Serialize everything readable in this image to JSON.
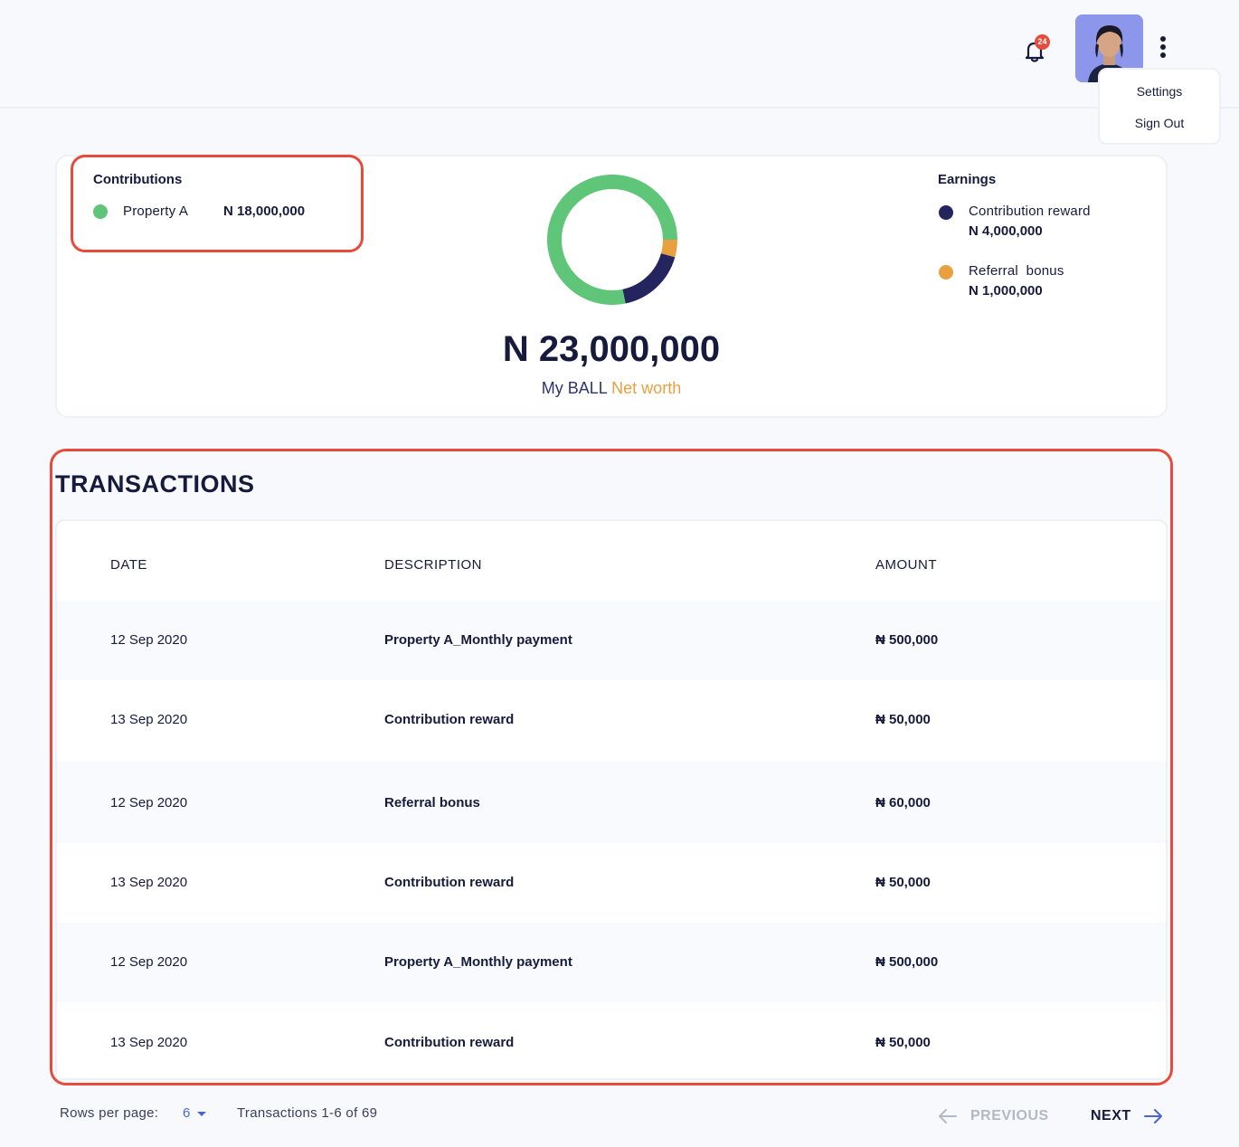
{
  "header": {
    "notification_count": "24",
    "menu": {
      "settings": "Settings",
      "sign_out": "Sign Out"
    }
  },
  "summary": {
    "contributions": {
      "heading": "Contributions",
      "items": [
        {
          "label": "Property A",
          "amount": "N 18,000,000",
          "color": "#5fc578"
        }
      ]
    },
    "earnings": {
      "heading": "Earnings",
      "items": [
        {
          "label": "Contribution reward",
          "amount": "N 4,000,000",
          "color": "#24245f"
        },
        {
          "label": "Referral  bonus",
          "amount": "N 1,000,000",
          "color": "#e9a03f"
        }
      ]
    },
    "networth_value": "N 23,000,000",
    "networth_label": "My BALL",
    "networth_accent": "Net worth"
  },
  "chart_data": {
    "type": "pie",
    "categories": [
      "Property A",
      "Contribution reward",
      "Referral bonus"
    ],
    "values": [
      18000000,
      4000000,
      1000000
    ],
    "colors": [
      "#5fc578",
      "#24245f",
      "#e9a03f"
    ]
  },
  "transactions": {
    "title": "TRANSACTIONS",
    "columns": {
      "date": "DATE",
      "description": "DESCRIPTION",
      "amount": "AMOUNT"
    },
    "rows": [
      {
        "date": "12 Sep 2020",
        "description": "Property A_Monthly payment",
        "amount": "₦ 500,000"
      },
      {
        "date": "13 Sep 2020",
        "description": "Contribution reward",
        "amount": "₦ 50,000"
      },
      {
        "date": "12 Sep 2020",
        "description": "Referral bonus",
        "amount": "₦ 60,000"
      },
      {
        "date": "13 Sep 2020",
        "description": "Contribution reward",
        "amount": "₦ 50,000"
      },
      {
        "date": "12 Sep 2020",
        "description": "Property A_Monthly payment",
        "amount": "₦ 500,000"
      },
      {
        "date": "13 Sep 2020",
        "description": "Contribution reward",
        "amount": "₦ 50,000"
      }
    ]
  },
  "pagination": {
    "rows_per_page_label": "Rows per page:",
    "rows_per_page_value": "6",
    "range_text": "Transactions 1-6 of 69",
    "previous": "PREVIOUS",
    "next": "NEXT"
  },
  "colors": {
    "accent": "#4a63d8",
    "highlight": "#e64b3b",
    "text": "#161b3d"
  }
}
